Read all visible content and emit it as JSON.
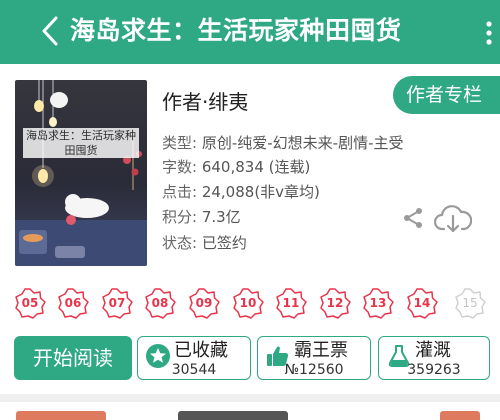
{
  "header": {
    "title": "海岛求生：生活玩家种田囤货",
    "bg_color": "#2fa884",
    "back_icon": "chevron-left-icon",
    "more_icon": "more-vertical-icon"
  },
  "book": {
    "cover_title": "海岛求生：生活玩家种田囤货",
    "author": "作者·绯夷",
    "author_column_label": "作者专栏",
    "meta": [
      {
        "label": "类型: ",
        "value": "原创-纯爱-幻想未来-剧情-主受"
      },
      {
        "label": "字数: ",
        "value": "640,834 (连载)"
      },
      {
        "label": "点击: ",
        "value": "24,088(非v章均)"
      },
      {
        "label": "积分: ",
        "value": "7.3亿"
      },
      {
        "label": "状态: ",
        "value": "已签约"
      }
    ],
    "share_icon": "share-icon",
    "download_icon": "cloud-download-icon"
  },
  "update_days": [
    {
      "label": "05",
      "active": true
    },
    {
      "label": "06",
      "active": true
    },
    {
      "label": "07",
      "active": true
    },
    {
      "label": "08",
      "active": true
    },
    {
      "label": "09",
      "active": true
    },
    {
      "label": "10",
      "active": true
    },
    {
      "label": "11",
      "active": true
    },
    {
      "label": "12",
      "active": true
    },
    {
      "label": "13",
      "active": true
    },
    {
      "label": "14",
      "active": true
    },
    {
      "label": "15",
      "active": false
    }
  ],
  "actions": {
    "read_label": "开始阅读",
    "collect": {
      "label": "已收藏",
      "count": "30544",
      "icon": "star-icon"
    },
    "vote": {
      "label": "霸王票",
      "count": "№12560",
      "icon": "thumbs-up-icon"
    },
    "irrigate": {
      "label": "灌溉",
      "count": "359263",
      "icon": "watering-flask-icon"
    }
  },
  "colors": {
    "accent": "#2fa884",
    "badge_red": "#e8334a",
    "badge_inactive": "#c4c4c4"
  }
}
